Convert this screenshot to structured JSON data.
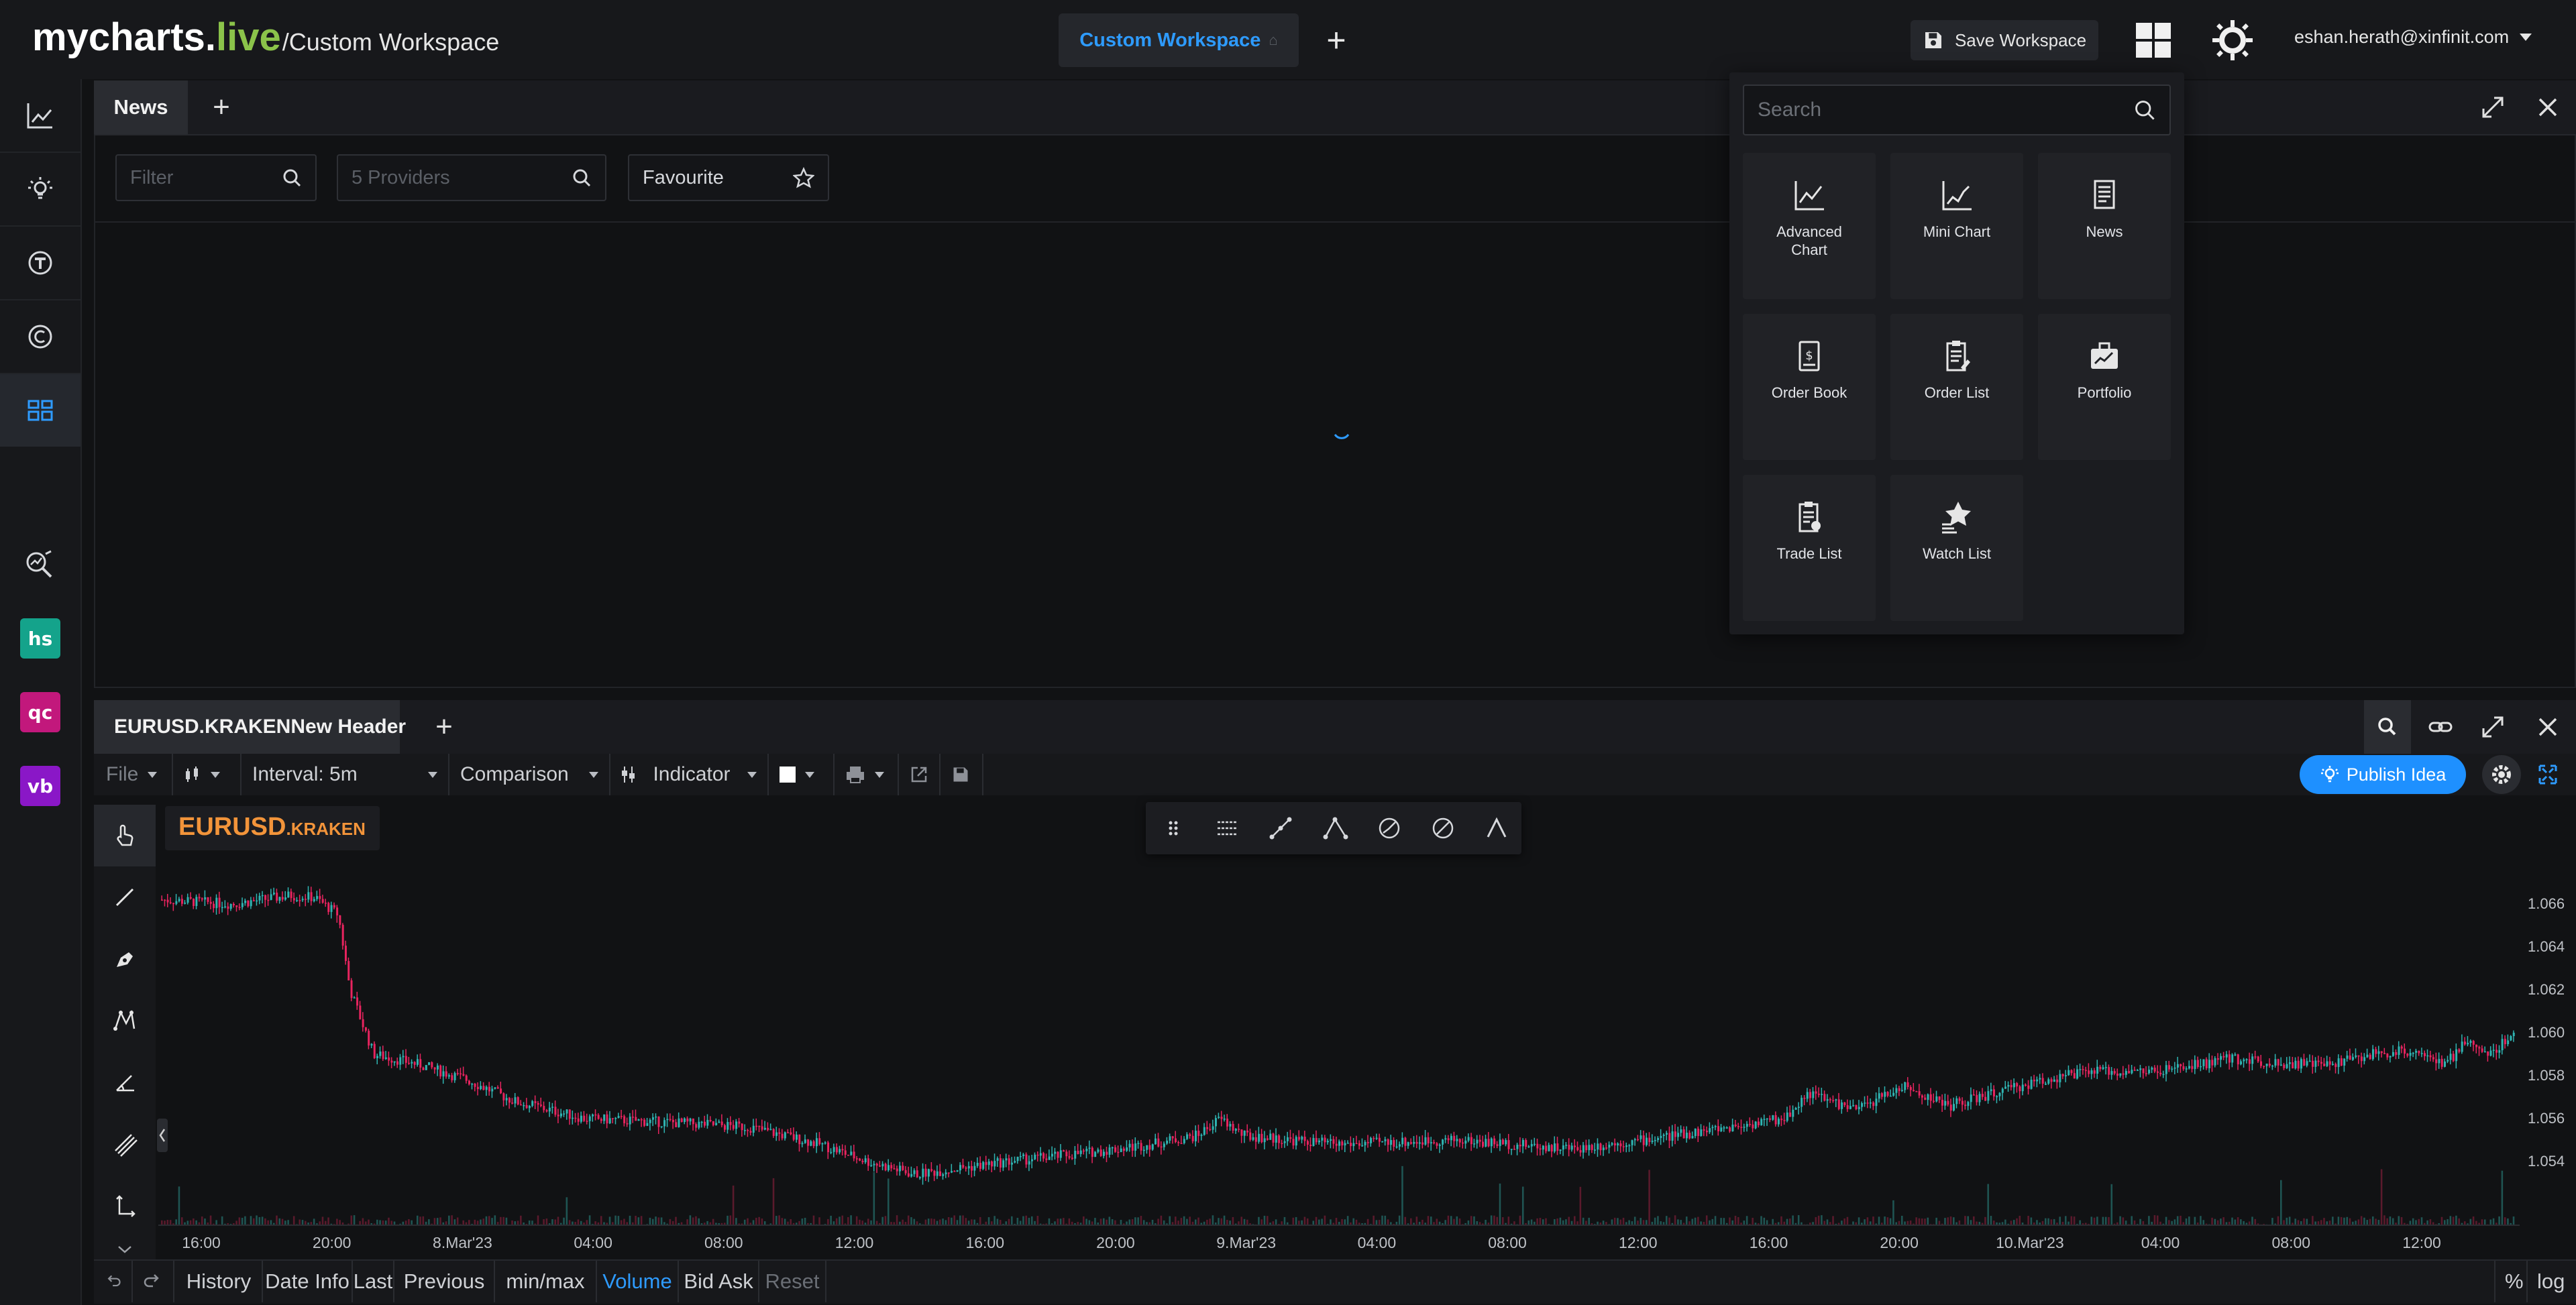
{
  "app": {
    "logo_main": "mycharts.",
    "logo_live": "live",
    "logo_sub": "/Custom Workspace"
  },
  "header": {
    "workspace_tab": "Custom Workspace",
    "save_workspace": "Save Workspace",
    "user_email": "eshan.herath@xinfinit.com"
  },
  "sidebar": {
    "badges": [
      {
        "label": "hs",
        "color": "#14a38b"
      },
      {
        "label": "qc",
        "color": "#c2187c"
      },
      {
        "label": "vb",
        "color": "#8a17c7"
      }
    ]
  },
  "news": {
    "tab": "News",
    "filter_placeholder": "Filter",
    "providers_placeholder": "5 Providers",
    "favourite": "Favourite"
  },
  "picker": {
    "search_placeholder": "Search",
    "tiles": [
      {
        "label": "Advanced Chart",
        "icon": "advanced-chart-icon"
      },
      {
        "label": "Mini Chart",
        "icon": "mini-chart-icon"
      },
      {
        "label": "News",
        "icon": "news-icon"
      },
      {
        "label": "Order Book",
        "icon": "order-book-icon"
      },
      {
        "label": "Order List",
        "icon": "order-list-icon"
      },
      {
        "label": "Portfolio",
        "icon": "portfolio-icon"
      },
      {
        "label": "Trade List",
        "icon": "trade-list-icon"
      },
      {
        "label": "Watch List",
        "icon": "watch-list-icon"
      }
    ]
  },
  "chart_panel": {
    "tab": "EURUSD.KRAKENNew Header",
    "toolbar": {
      "file": "File",
      "interval": "Interval: 5m",
      "comparison": "Comparison",
      "indicator": "Indicator",
      "publish": "Publish Idea"
    },
    "symbol_main": "EURUSD",
    "symbol_exchange": ".KRAKEN",
    "bottom": [
      "History",
      "Date Info",
      "Last",
      "Previous",
      "min/max",
      "Volume",
      "Bid Ask",
      "Reset"
    ],
    "bottom_active": "Volume",
    "bottom_disabled": "Reset",
    "right_buttons": [
      "%",
      "log"
    ]
  },
  "chart_data": {
    "type": "candlestick",
    "symbol": "EURUSD.KRAKEN",
    "interval": "5m",
    "y_ticks": [
      "1.066",
      "1.064",
      "1.062",
      "1.060",
      "1.058",
      "1.056",
      "1.054"
    ],
    "ylim": [
      1.0525,
      1.0675
    ],
    "x_ticks": [
      "16:00",
      "20:00",
      "8.Mar'23",
      "04:00",
      "08:00",
      "12:00",
      "16:00",
      "20:00",
      "9.Mar'23",
      "04:00",
      "08:00",
      "12:00",
      "16:00",
      "20:00",
      "10.Mar'23",
      "04:00",
      "08:00",
      "12:00"
    ],
    "price_path": [
      [
        0,
        1.0662
      ],
      [
        0.03,
        1.066
      ],
      [
        0.055,
        1.0664
      ],
      [
        0.065,
        1.0663
      ],
      [
        0.075,
        1.0655
      ],
      [
        0.08,
        1.062
      ],
      [
        0.09,
        1.059
      ],
      [
        0.11,
        1.0585
      ],
      [
        0.13,
        1.0578
      ],
      [
        0.15,
        1.0568
      ],
      [
        0.18,
        1.056
      ],
      [
        0.22,
        1.0558
      ],
      [
        0.25,
        1.0556
      ],
      [
        0.28,
        1.0548
      ],
      [
        0.3,
        1.054
      ],
      [
        0.32,
        1.0534
      ],
      [
        0.36,
        1.054
      ],
      [
        0.4,
        1.0545
      ],
      [
        0.42,
        1.0548
      ],
      [
        0.44,
        1.0552
      ],
      [
        0.45,
        1.056
      ],
      [
        0.46,
        1.0552
      ],
      [
        0.5,
        1.0548
      ],
      [
        0.55,
        1.055
      ],
      [
        0.6,
        1.0546
      ],
      [
        0.63,
        1.055
      ],
      [
        0.66,
        1.0555
      ],
      [
        0.69,
        1.056
      ],
      [
        0.7,
        1.0572
      ],
      [
        0.72,
        1.0564
      ],
      [
        0.74,
        1.0575
      ],
      [
        0.76,
        1.0566
      ],
      [
        0.78,
        1.0572
      ],
      [
        0.8,
        1.0578
      ],
      [
        0.82,
        1.0582
      ],
      [
        0.85,
        1.0582
      ],
      [
        0.88,
        1.0588
      ],
      [
        0.9,
        1.0586
      ],
      [
        0.92,
        1.0585
      ],
      [
        0.94,
        1.059
      ],
      [
        0.96,
        1.0592
      ],
      [
        0.97,
        1.0584
      ],
      [
        0.98,
        1.0596
      ],
      [
        0.99,
        1.059
      ],
      [
        1.0,
        1.06
      ]
    ]
  }
}
